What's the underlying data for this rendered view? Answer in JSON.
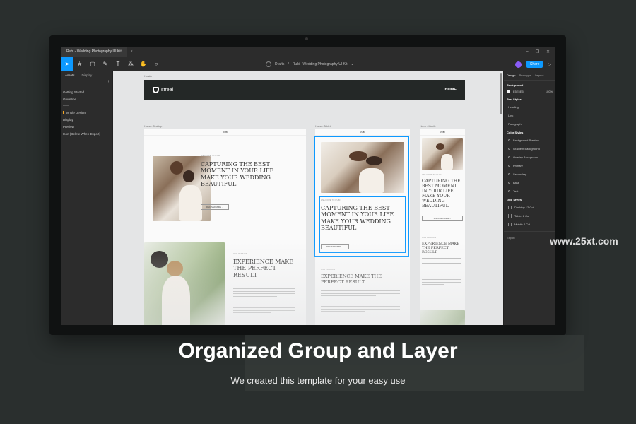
{
  "app": {
    "tab_title": "Rubi - Wedding Photography UI Kit",
    "breadcrumb_location": "Drafts",
    "breadcrumb_file": "Rubi - Wedding Photography UI Kit",
    "share_label": "Share"
  },
  "left_panel": {
    "tabs": [
      "Assets",
      "Display"
    ],
    "pages": [
      {
        "label": "Getting Started"
      },
      {
        "label": "Guideline"
      },
      {
        "label": "Whole Design"
      },
      {
        "label": "Display"
      },
      {
        "label": "Preview"
      },
      {
        "label": "Icon (Delete When Export)"
      }
    ]
  },
  "canvas": {
    "frames": {
      "header": "Header",
      "desktop": "Home - Desktop",
      "tablet": "Home - Tablet",
      "mobile": "Home - Mobile"
    },
    "header": {
      "logo": "streal",
      "home_link": "HOME"
    },
    "hero": {
      "eyebrow": "WELCOME TO RUBI",
      "headline": "CAPTURING THE BEST MOMENT IN YOUR LIFE MAKE YOUR WEDDING BEAUTIFUL",
      "button": "DISCOVER MORE →"
    },
    "experience": {
      "eyebrow": "OUR PASSION",
      "headline": "EXPERIENCE MAKE THE PERFECT RESULT"
    },
    "mini_logo": "RUBI"
  },
  "right_panel": {
    "tabs": [
      "Design",
      "Prototype",
      "Inspect"
    ],
    "background": {
      "title": "Background",
      "hex": "E5E5E5",
      "opacity": "100%"
    },
    "text_styles": {
      "title": "Text Styles",
      "items": [
        "Heading",
        "Link",
        "Paragraph"
      ]
    },
    "color_styles": {
      "title": "Color Styles",
      "items": [
        "Background Preview",
        "Gradient Background",
        "Overlay Background",
        "Primary",
        "Secondary",
        "Base",
        "Text"
      ]
    },
    "grid_styles": {
      "title": "Grid Styles",
      "items": [
        "Desktop 12 Col",
        "Tablet 8 Col",
        "Mobile 4 Col"
      ]
    },
    "export": "Export"
  },
  "overlay": {
    "watermark": "www.25xt.com",
    "caption": "Organized Group and Layer",
    "subcaption": "We created this template for your easy use"
  },
  "colors": {
    "accent": "#0d99ff",
    "panel": "#2c2c2c",
    "page_bg": "#2a2f2e"
  }
}
